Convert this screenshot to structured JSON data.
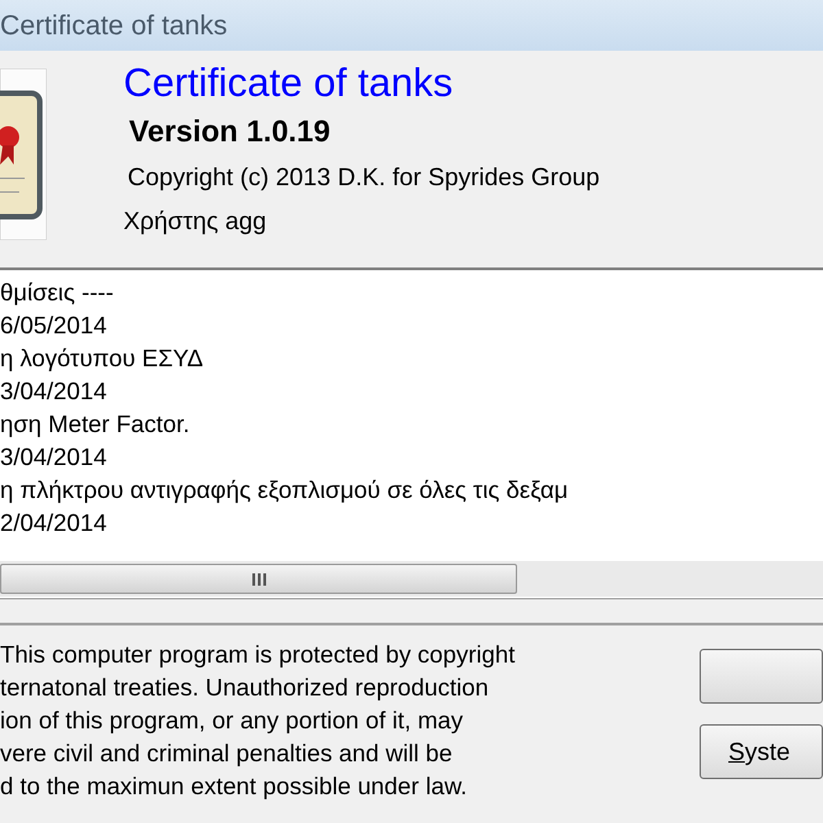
{
  "window": {
    "title": "Certificate of tanks"
  },
  "header": {
    "app_name": "Certificate of tanks",
    "version": "Version 1.0.19",
    "copyright": "Copyright (c) 2013 D.K. for Spyrides Group",
    "user": "Χρήστης agg"
  },
  "changelog": {
    "lines": [
      "θμίσεις ----",
      "6/05/2014",
      "η λογότυπου ΕΣΥΔ",
      "3/04/2014",
      "ηση Meter Factor.",
      "3/04/2014",
      "η πλήκτρου αντιγραφής εξοπλισμού σε όλες τις δεξαμ",
      "2/04/2014"
    ]
  },
  "warning": {
    "lines": [
      "This computer program is protected by copyright",
      "ternatonal treaties. Unauthorized reproduction",
      "ion of this program, or any portion of it, may",
      "vere civil and criminal penalties and will be",
      "d to the maximun extent possible under law."
    ]
  },
  "buttons": [
    {
      "kind": "blank"
    },
    {
      "kind": "text",
      "label": "Syste",
      "underline_first": true
    }
  ]
}
